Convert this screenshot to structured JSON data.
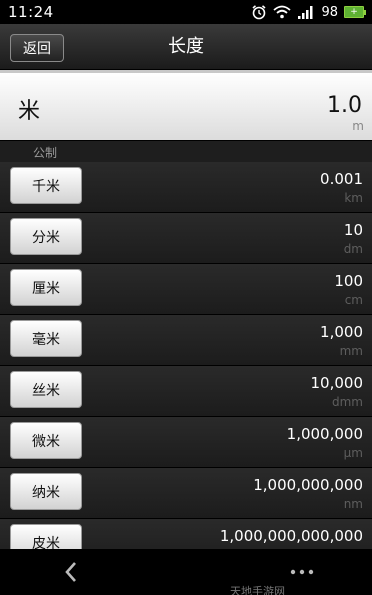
{
  "status_bar": {
    "time": "11:24",
    "battery_level": "98",
    "icons": [
      "alarm-icon",
      "wifi-icon",
      "signal-icon",
      "battery-icon"
    ]
  },
  "header": {
    "back_label": "返回",
    "title": "长度"
  },
  "current": {
    "unit_name": "米",
    "value": "1.0",
    "abbr": "m"
  },
  "section": {
    "label": "公制"
  },
  "units": [
    {
      "name": "千米",
      "value": "0.001",
      "abbr": "km"
    },
    {
      "name": "分米",
      "value": "10",
      "abbr": "dm"
    },
    {
      "name": "厘米",
      "value": "100",
      "abbr": "cm"
    },
    {
      "name": "毫米",
      "value": "1,000",
      "abbr": "mm"
    },
    {
      "name": "丝米",
      "value": "10,000",
      "abbr": "dmm"
    },
    {
      "name": "微米",
      "value": "1,000,000",
      "abbr": "μm"
    },
    {
      "name": "纳米",
      "value": "1,000,000,000",
      "abbr": "nm"
    },
    {
      "name": "皮米",
      "value": "1,000,000,000,000",
      "abbr": ""
    }
  ],
  "bottom_nav": {
    "icons": [
      "back-chevron-icon",
      "more-dots-icon"
    ],
    "watermark": "天地手游网"
  },
  "colors": {
    "battery": "#5fb233",
    "row_bg": "#242424",
    "muted_text": "#5e5e5e"
  }
}
